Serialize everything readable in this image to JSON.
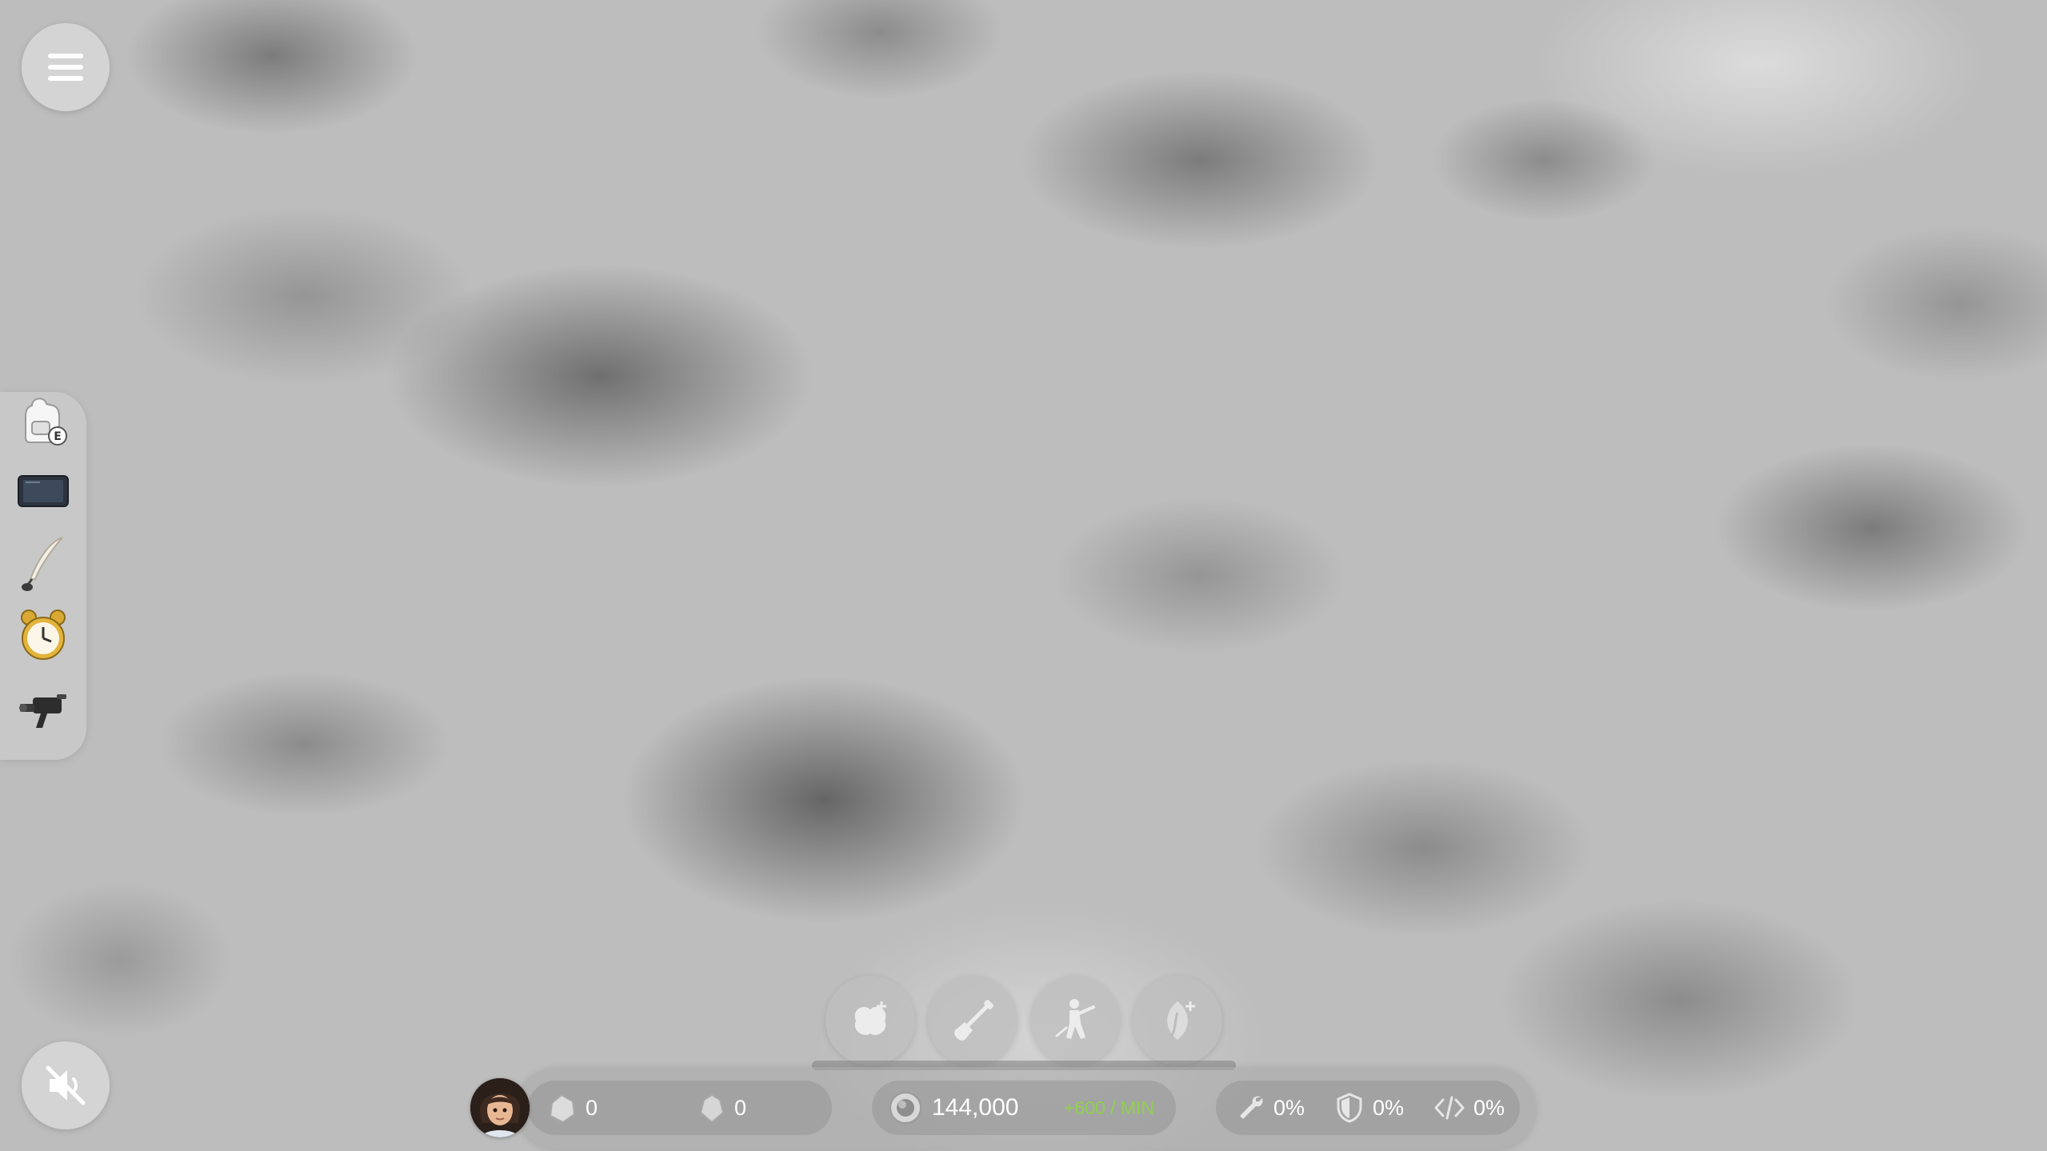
{
  "menu_button": {
    "icon": "hamburger-menu-icon"
  },
  "sound_button": {
    "icon": "sound-muted-icon"
  },
  "left_dock": {
    "items": [
      {
        "icon": "backpack-icon",
        "hotkey": "E"
      },
      {
        "icon": "tablet-device-icon"
      },
      {
        "icon": "quill-pen-icon"
      },
      {
        "icon": "alarm-clock-icon"
      },
      {
        "icon": "camera-drone-icon"
      }
    ]
  },
  "actions": [
    {
      "icon": "plant-add-icon"
    },
    {
      "icon": "shovel-icon"
    },
    {
      "icon": "miner-icon"
    },
    {
      "icon": "seed-add-icon"
    }
  ],
  "status": {
    "resource_a": {
      "icon": "ore-chunk-icon",
      "value": "0"
    },
    "resource_b": {
      "icon": "crystal-icon",
      "value": "0"
    },
    "coins": {
      "icon": "coin-icon",
      "value": "144,000",
      "rate": "+600 / MIN"
    },
    "repair": {
      "icon": "wrench-icon",
      "value": "0%"
    },
    "defense": {
      "icon": "shield-icon",
      "value": "0%"
    },
    "code": {
      "icon": "code-icon",
      "value": "0%"
    }
  },
  "colors": {
    "rate_green": "#8fd24a",
    "text_white": "#ffffff"
  }
}
